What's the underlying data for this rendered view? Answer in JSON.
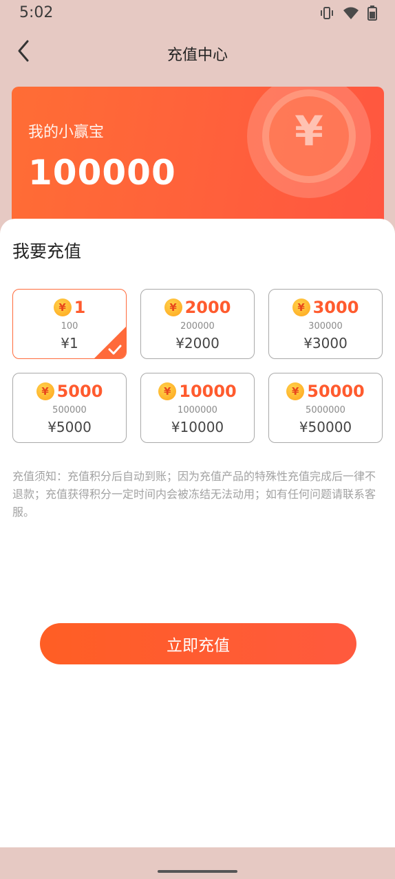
{
  "status_bar": {
    "time": "5:02",
    "icons": [
      "vibrate-icon",
      "wifi-icon",
      "battery-icon"
    ]
  },
  "nav": {
    "title": "充值中心",
    "back_icon": "chevron-left-icon"
  },
  "balance": {
    "label": "我的小赢宝",
    "value": "100000",
    "coin_symbol": "¥"
  },
  "recharge": {
    "section_title": "我要充值",
    "coin_glyph": "¥",
    "options": [
      {
        "points": "1",
        "sub": "100",
        "price": "¥1",
        "selected": true
      },
      {
        "points": "2000",
        "sub": "200000",
        "price": "¥2000",
        "selected": false
      },
      {
        "points": "3000",
        "sub": "300000",
        "price": "¥3000",
        "selected": false
      },
      {
        "points": "5000",
        "sub": "500000",
        "price": "¥5000",
        "selected": false
      },
      {
        "points": "10000",
        "sub": "1000000",
        "price": "¥10000",
        "selected": false
      },
      {
        "points": "50000",
        "sub": "5000000",
        "price": "¥50000",
        "selected": false
      }
    ],
    "notice": "充值须知：充值积分后自动到账；因为充值产品的特殊性充值完成后一律不退款；充值获得积分一定时间内会被冻结无法动用；如有任何问题请联系客服。",
    "button_label": "立即充值"
  },
  "colors": {
    "accent": "#ff5b2e",
    "card": "#ff6535",
    "background": "#e6c9c3",
    "border": "#a9a9a9"
  }
}
